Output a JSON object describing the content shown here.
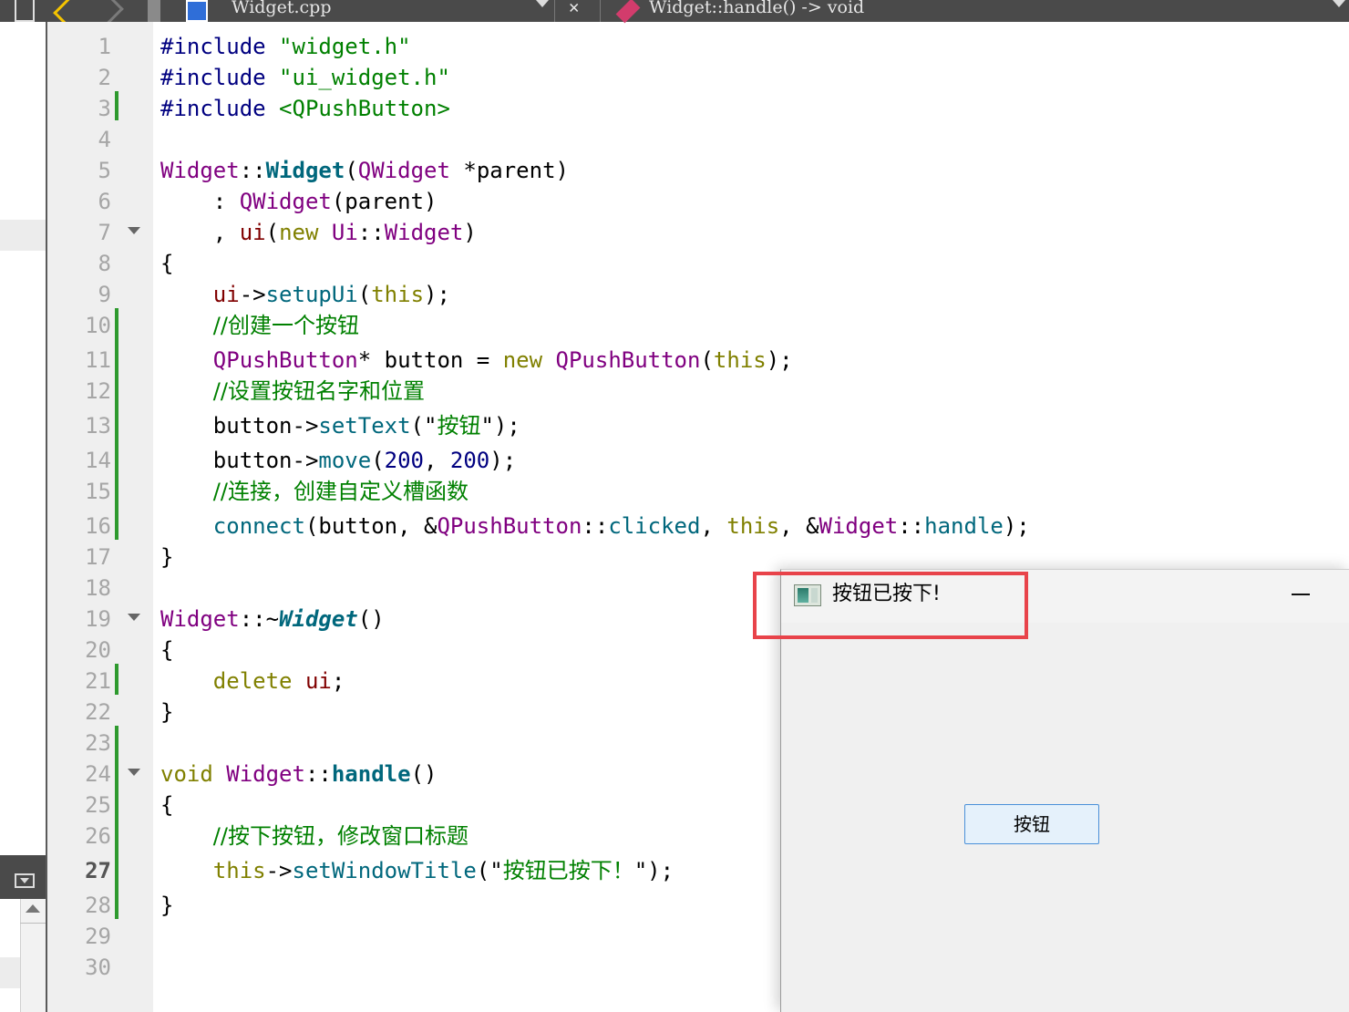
{
  "toolbar": {
    "file_name": "Widget.cpp",
    "symbol": "Widget::handle() -> void"
  },
  "editor": {
    "current_line": 27,
    "line_numbers": [
      "1",
      "2",
      "3",
      "4",
      "5",
      "6",
      "7",
      "8",
      "9",
      "10",
      "11",
      "12",
      "13",
      "14",
      "15",
      "16",
      "17",
      "18",
      "19",
      "20",
      "21",
      "22",
      "23",
      "24",
      "25",
      "26",
      "27",
      "28",
      "29",
      "30"
    ],
    "code": {
      "l1": [
        "#include",
        " ",
        "\"widget.h\""
      ],
      "l2": [
        "#include",
        " ",
        "\"ui_widget.h\""
      ],
      "l3": [
        "#include",
        " ",
        "<QPushButton>"
      ],
      "l5": [
        "Widget",
        "::",
        "Widget",
        "(",
        "QWidget",
        " *parent)"
      ],
      "l6": [
        "    : ",
        "QWidget",
        "(parent)"
      ],
      "l7": [
        "    , ",
        "ui",
        "(",
        "new",
        " ",
        "Ui",
        "::",
        "Widget",
        ")"
      ],
      "l8": [
        "{"
      ],
      "l9": [
        "    ",
        "ui",
        "->",
        "setupUi",
        "(",
        "this",
        ");"
      ],
      "l10": [
        "    ",
        "//创建一个按钮"
      ],
      "l11": [
        "    ",
        "QPushButton",
        "* button = ",
        "new",
        " ",
        "QPushButton",
        "(",
        "this",
        ");"
      ],
      "l12": [
        "    ",
        "//设置按钮名字和位置"
      ],
      "l13": [
        "    button->",
        "setText",
        "(\"",
        "按钮",
        "\");"
      ],
      "l14": [
        "    button->",
        "move",
        "(",
        "200",
        ", ",
        "200",
        ");"
      ],
      "l15": [
        "    ",
        "//连接，创建自定义槽函数"
      ],
      "l16": [
        "    ",
        "connect",
        "(button, &",
        "QPushButton",
        "::",
        "clicked",
        ", ",
        "this",
        ", &",
        "Widget",
        "::",
        "handle",
        ");"
      ],
      "l17": [
        "}"
      ],
      "l19": [
        "Widget",
        "::~",
        "Widget",
        "()"
      ],
      "l20": [
        "{"
      ],
      "l21": [
        "    ",
        "delete",
        " ",
        "ui",
        ";"
      ],
      "l22": [
        "}"
      ],
      "l24": [
        "void",
        " ",
        "Widget",
        "::",
        "handle",
        "()"
      ],
      "l25": [
        "{"
      ],
      "l26": [
        "    ",
        "//按下按钮，修改窗口标题"
      ],
      "l27": [
        "    ",
        "this",
        "->",
        "setWindowTitle",
        "(\"",
        "按钮已按下！",
        "\");"
      ],
      "l28": [
        "}"
      ]
    }
  },
  "app_window": {
    "title": "按钮已按下!",
    "button_label": "按钮"
  },
  "colors": {
    "preprocessor": "#000080",
    "string": "#008000",
    "type": "#800080",
    "function": "#00677c",
    "keyword": "#808000",
    "comment": "#008000",
    "highlight_box": "#e8434a",
    "modified_marker": "#2e9a2e"
  }
}
